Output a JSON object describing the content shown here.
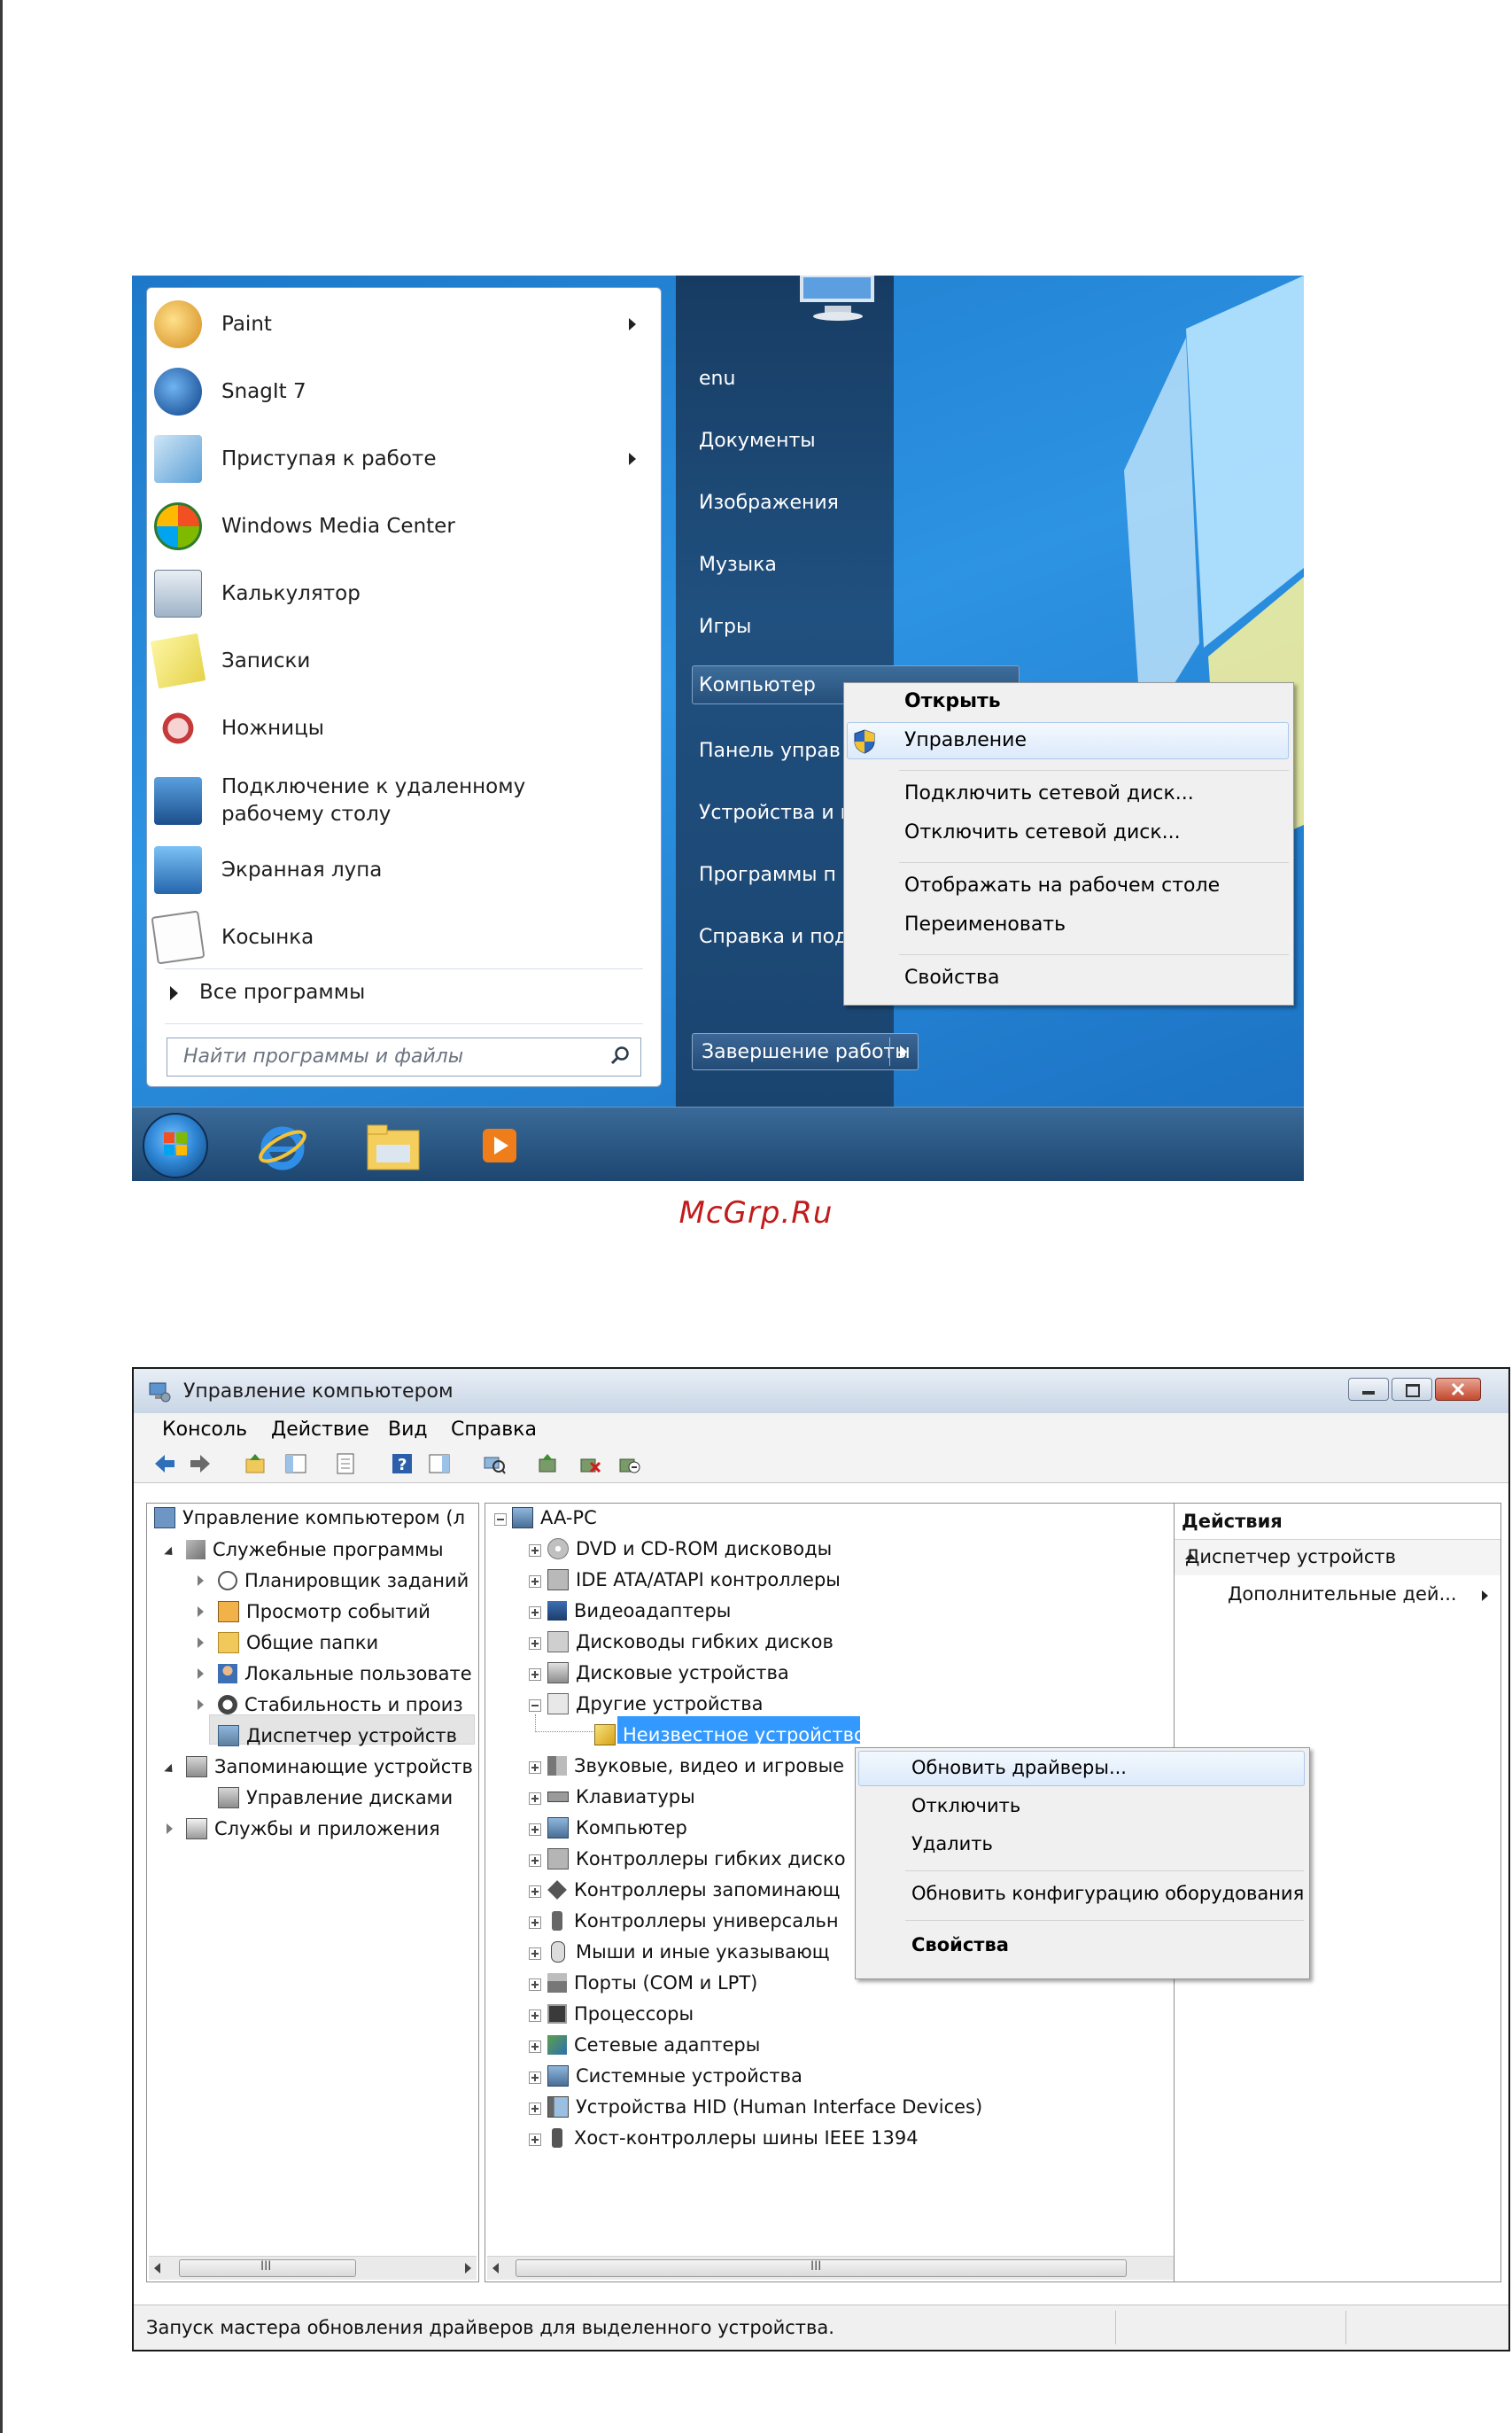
{
  "start_menu": {
    "programs": [
      {
        "label": "Paint",
        "has_submenu": true
      },
      {
        "label": "SnagIt 7",
        "has_submenu": false
      },
      {
        "label": "Приступая к работе",
        "has_submenu": true
      },
      {
        "label": "Windows Media Center",
        "has_submenu": false
      },
      {
        "label": "Калькулятор",
        "has_submenu": false
      },
      {
        "label": "Записки",
        "has_submenu": false
      },
      {
        "label": "Ножницы",
        "has_submenu": false
      },
      {
        "label": "Подключение к удаленному рабочему столу",
        "has_submenu": false
      },
      {
        "label": "Экранная лупа",
        "has_submenu": false
      },
      {
        "label": "Косынка",
        "has_submenu": false
      }
    ],
    "all_programs": "Все программы",
    "search_placeholder": "Найти программы и файлы",
    "right_links": [
      "enu",
      "Документы",
      "Изображения",
      "Музыка",
      "Игры",
      "Компьютер",
      "Панель управ",
      "Устройства и г",
      "Программы п",
      "Справка и под"
    ],
    "shutdown_label": "Завершение работы"
  },
  "computer_context_menu": {
    "items": [
      "Открыть",
      "Управление",
      "Подключить сетевой диск...",
      "Отключить сетевой диск...",
      "Отображать на рабочем столе",
      "Переименовать",
      "Свойства"
    ]
  },
  "watermark": "McGrp.Ru",
  "mgmt_window": {
    "title": "Управление компьютером",
    "menu": [
      "Консоль",
      "Действие",
      "Вид",
      "Справка"
    ],
    "left_tree": [
      "Управление компьютером (л",
      "Служебные программы",
      "Планировщик заданий",
      "Просмотр событий",
      "Общие папки",
      "Локальные пользовате",
      "Стабильность и произ",
      "Диспетчер устройств",
      "Запоминающие устройств",
      "Управление дисками",
      "Службы и приложения"
    ],
    "device_tree": {
      "root": "AA-PC",
      "categories": [
        "DVD и CD-ROM дисководы",
        "IDE ATA/ATAPI контроллеры",
        "Видеоадаптеры",
        "Дисководы гибких дисков",
        "Дисковые устройства",
        "Другие устройства",
        "Неизвестное устройство",
        "Звуковые, видео и игровые",
        "Клавиатуры",
        "Компьютер",
        "Контроллеры гибких диско",
        "Контроллеры запоминающ",
        "Контроллеры универсальн",
        "Мыши и иные указывающ",
        "Порты (COM и LPT)",
        "Процессоры",
        "Сетевые адаптеры",
        "Системные устройства",
        "Устройства HID (Human Interface Devices)",
        "Хост-контроллеры шины IEEE 1394"
      ]
    },
    "actions": {
      "header": "Действия",
      "section": "Диспетчер устройств",
      "more": "Дополнительные дей..."
    },
    "device_context_menu": [
      "Обновить драйверы...",
      "Отключить",
      "Удалить",
      "Обновить конфигурацию оборудования",
      "Свойства"
    ],
    "scroll_grip": "III",
    "status": "Запуск мастера обновления драйверов для выделенного устройства."
  },
  "colors": {
    "selection": "#3399ff",
    "start_right_panel": "#1f4d7b",
    "watermark": "#c21b1b"
  }
}
